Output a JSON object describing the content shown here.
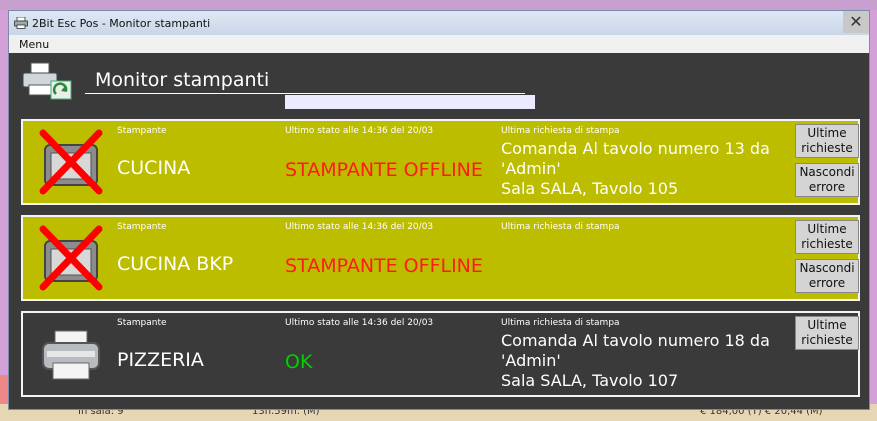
{
  "window": {
    "title": "2Bit Esc Pos - Monitor stampanti",
    "close_glyph": "✕",
    "menu": [
      "Menu"
    ]
  },
  "header": {
    "title": "Monitor stampanti",
    "icon": "printer-refresh-icon"
  },
  "labels": {
    "printer": "Stampante",
    "last_request": "Ultima richiesta di stampa"
  },
  "printers": [
    {
      "name": "CUCINA",
      "state_time": "Ultimo stato alle 14:36 del 20/03",
      "status": "STAMPANTE OFFLINE",
      "request_line1": "Comanda Al tavolo numero 13 da",
      "request_line2": "'Admin'",
      "request_line3": "Sala SALA, Tavolo 105",
      "btn_last": "Ultime richieste",
      "btn_hide": "Nascondi errore",
      "state_color": "#bdbd00",
      "icon": "printer-offline-icon"
    },
    {
      "name": "CUCINA BKP",
      "state_time": "Ultimo stato alle 14:36 del 20/03",
      "status": "STAMPANTE OFFLINE",
      "request_line1": "",
      "request_line2": "",
      "request_line3": "",
      "btn_last": "Ultime richieste",
      "btn_hide": "Nascondi errore",
      "state_color": "#bdbd00",
      "icon": "printer-offline-icon"
    },
    {
      "name": "PIZZERIA",
      "state_time": "Ultimo stato alle 14:36 del 20/03",
      "status": "OK",
      "request_line1": "Comanda Al tavolo numero 18 da",
      "request_line2": "'Admin'",
      "request_line3": "Sala SALA, Tavolo 107",
      "btn_last": "Ultime richieste",
      "state_color": "#3a3a3a",
      "icon": "printer-ok-icon"
    }
  ],
  "background_app": {
    "footer_1": "In sala: 9",
    "footer_2": "13h.59m. (M)",
    "footer_3": "€ 184,00 (T) € 20,44 (M)"
  }
}
